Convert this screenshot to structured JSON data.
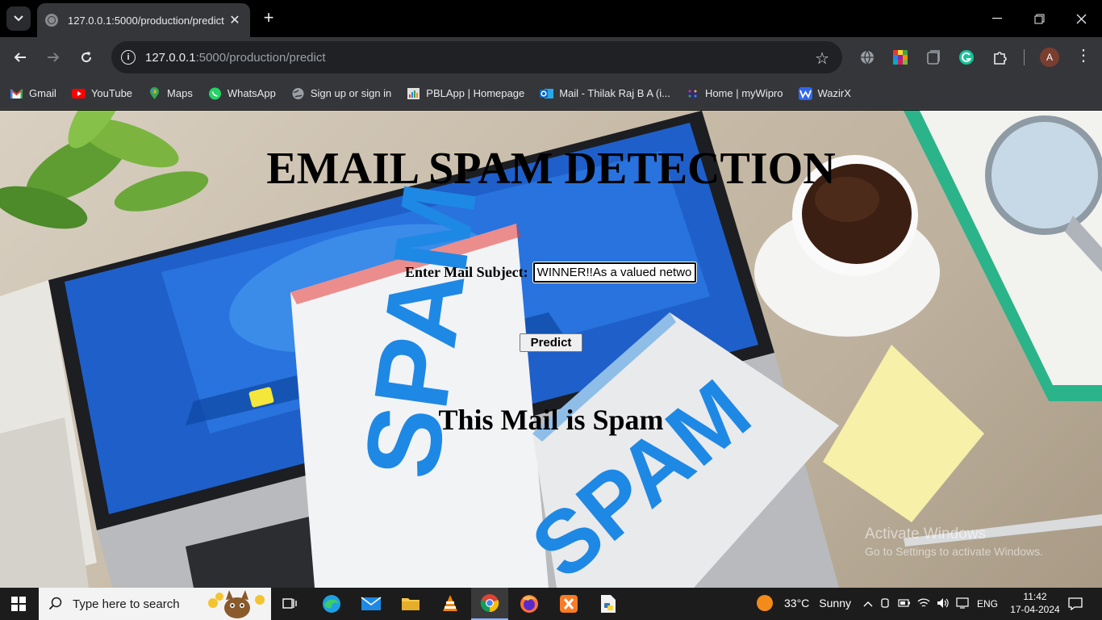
{
  "browser": {
    "tab_title": "127.0.0.1:5000/production/predict",
    "url_host": "127.0.0.1",
    "url_rest": ":5000/production/predict",
    "profile_initial": "A"
  },
  "bookmarks": [
    {
      "label": "Gmail",
      "icon": "gmail-icon",
      "color": "#ea4335"
    },
    {
      "label": "YouTube",
      "icon": "youtube-icon",
      "color": "#ff0000"
    },
    {
      "label": "Maps",
      "icon": "maps-icon",
      "color": "#34a853"
    },
    {
      "label": "WhatsApp",
      "icon": "whatsapp-icon",
      "color": "#25d366"
    },
    {
      "label": "Sign up or sign in",
      "icon": "globe-icon",
      "color": "#9aa0a6"
    },
    {
      "label": "PBLApp | Homepage",
      "icon": "pblapp-icon",
      "color": "#d0d0d0"
    },
    {
      "label": "Mail - Thilak Raj B A (i...",
      "icon": "outlook-icon",
      "color": "#0a64c9"
    },
    {
      "label": "Home | myWipro",
      "icon": "wipro-icon",
      "color": "#5b5bd6"
    },
    {
      "label": "WazirX",
      "icon": "wazirx-icon",
      "color": "#3067f0"
    }
  ],
  "page": {
    "title": "EMAIL SPAM DETECTION",
    "subject_label": "Enter Mail Subject:",
    "subject_value": "WINNER!!As a valued netwo",
    "predict_label": "Predict",
    "result": "This Mail is Spam"
  },
  "watermark": {
    "line1": "Activate Windows",
    "line2": "Go to Settings to activate Windows."
  },
  "taskbar": {
    "search_placeholder": "Type here to search",
    "weather_temp": "33°C",
    "weather_desc": "Sunny",
    "language": "ENG",
    "time": "11:42",
    "date": "17-04-2024"
  }
}
